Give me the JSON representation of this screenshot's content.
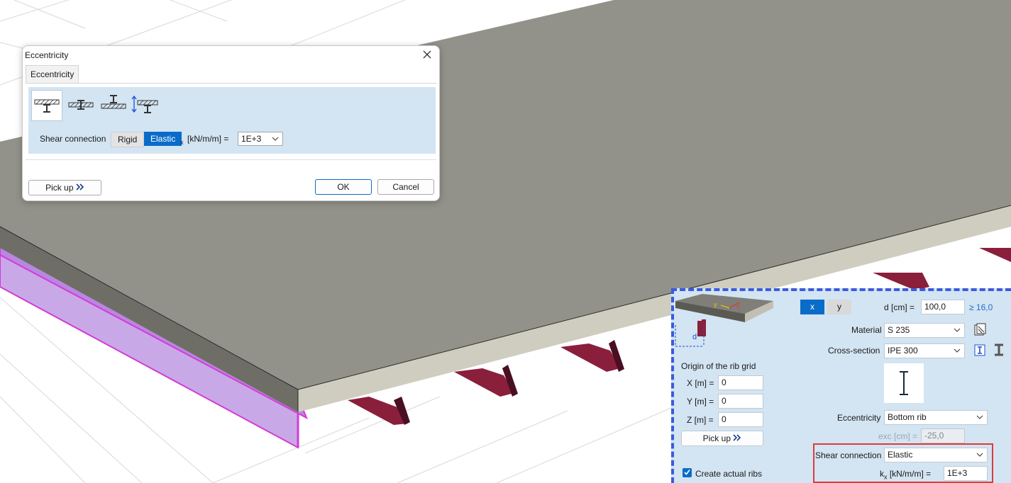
{
  "dialog": {
    "title": "Eccentricity",
    "tab": "Eccentricity",
    "ecc_options": [
      "slab-on-beam-icon",
      "embedded-beam-icon",
      "beam-above-slab-icon",
      "custom-offset-icon"
    ],
    "shear_label": "Shear connection",
    "rigid_label": "Rigid",
    "elastic_label": "Elastic",
    "kx_sub": "x",
    "kx_unit": "[kN/m/m] =",
    "kx_value": "1E+3",
    "pickup_label": "Pick up",
    "ok_label": "OK",
    "cancel_label": "Cancel"
  },
  "panel": {
    "tab_x": "x",
    "tab_y": "y",
    "d_label": "d [cm] =",
    "d_value": "100,0",
    "d_min": "≥ 16,0",
    "preview_d": "d",
    "preview_x": "x",
    "preview_y": "y",
    "material_label": "Material",
    "material_value": "S 235",
    "cross_label": "Cross-section",
    "cross_value": "IPE 300",
    "origin_title": "Origin of the rib grid",
    "x_label": "X [m] =",
    "x_value": "0",
    "y_label": "Y [m] =",
    "y_value": "0",
    "z_label": "Z [m] =",
    "z_value": "0",
    "pickup_label": "Pick up",
    "ecc_label": "Eccentricity",
    "ecc_value": "Bottom rib",
    "exc_label": "exc [cm] =",
    "exc_value": "-25,0",
    "shear_label": "Shear connection",
    "shear_value": "Elastic",
    "kx_k": "k",
    "kx_sub": "x",
    "kx_unit": "[kN/m/m] =",
    "kx_value": "1E+3",
    "create_ribs_label": "Create actual ribs"
  },
  "colors": {
    "accent": "#0a6cc9",
    "panel_bg": "#d3e4f2",
    "slab_top": "#93928a",
    "slab_side": "#cfcdbf",
    "rib": "#8a1f3c",
    "highlight": "#d23bd6",
    "dashed_border": "#3a5ae0",
    "red_outline": "#e03a3a"
  }
}
